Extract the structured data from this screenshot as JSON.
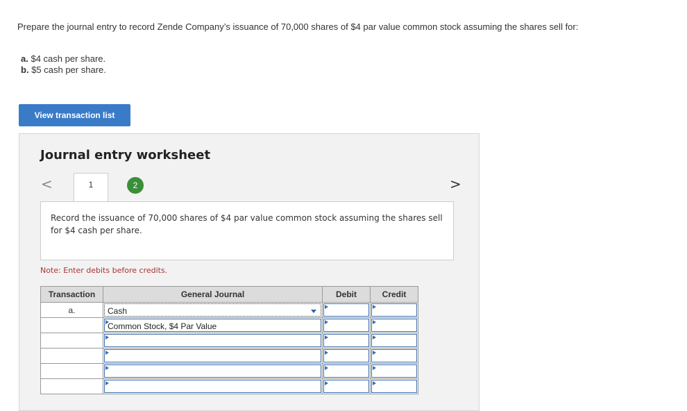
{
  "question": "Prepare the journal entry to record Zende Company’s issuance of 70,000 shares of $4 par value common stock assuming the shares sell for:",
  "options": [
    {
      "letter": "a.",
      "text": "$4 cash per share."
    },
    {
      "letter": "b.",
      "text": "$5 cash per share."
    }
  ],
  "view_button": "View transaction list",
  "worksheet": {
    "title": "Journal entry worksheet",
    "nav_prev": "<",
    "nav_next": ">",
    "tab1": "1",
    "tab2": "2",
    "prompt": "Record the issuance of 70,000 shares of $4 par value common stock assuming the shares sell for $4 cash per share.",
    "note": "Note: Enter debits before credits.",
    "table": {
      "headers": [
        "Transaction",
        "General Journal",
        "Debit",
        "Credit"
      ],
      "rows": [
        {
          "transaction": "a.",
          "account": "Cash",
          "debit": "",
          "credit": ""
        },
        {
          "transaction": "",
          "account": "Common Stock, $4 Par Value",
          "debit": "",
          "credit": ""
        },
        {
          "transaction": "",
          "account": "",
          "debit": "",
          "credit": ""
        },
        {
          "transaction": "",
          "account": "",
          "debit": "",
          "credit": ""
        },
        {
          "transaction": "",
          "account": "",
          "debit": "",
          "credit": ""
        },
        {
          "transaction": "",
          "account": "",
          "debit": "",
          "credit": ""
        }
      ]
    }
  },
  "colors": {
    "button": "#3a7bc8",
    "tab_active": "#3b8f3b",
    "note": "#a33333"
  }
}
